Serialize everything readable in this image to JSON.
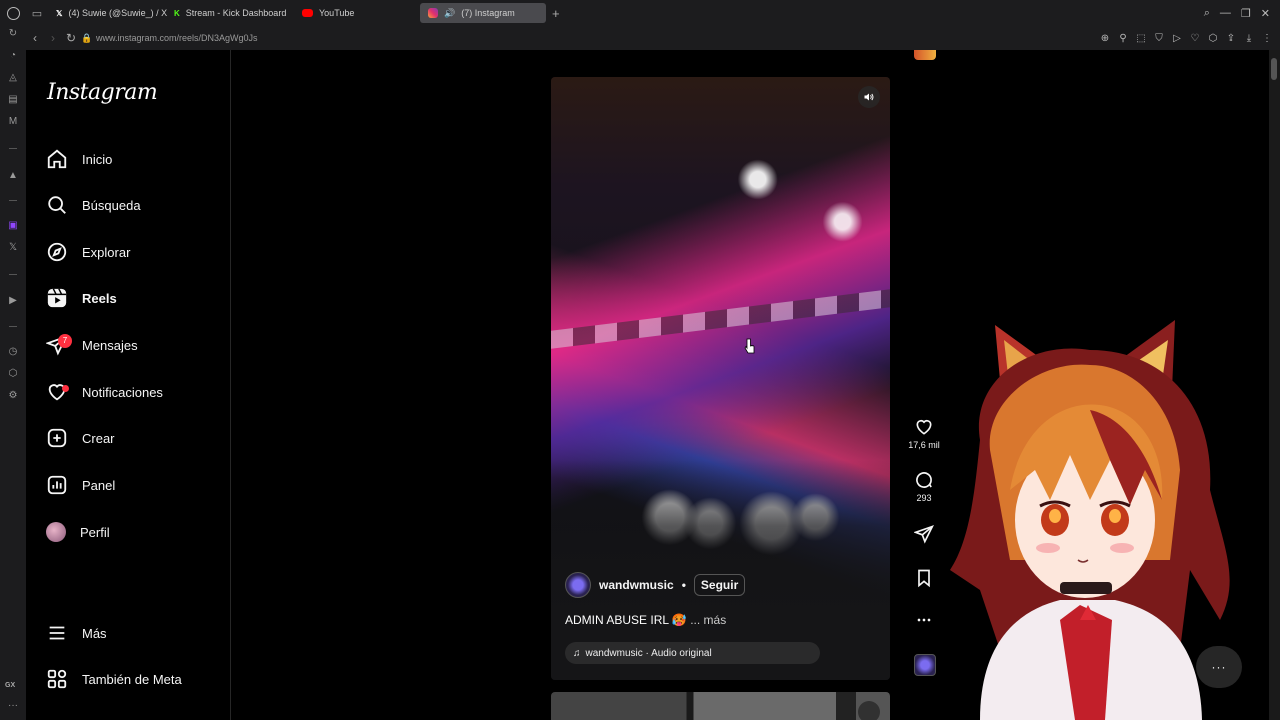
{
  "browser": {
    "tabs": [
      {
        "title": "(4) Suwie (@Suwie_) / X",
        "icon": "x-icon"
      },
      {
        "title": "Stream - Kick Dashboard",
        "icon": "kick-icon"
      },
      {
        "title": "YouTube",
        "icon": "youtube-icon"
      },
      {
        "title": "(7) Instagram",
        "icon": "instagram-icon",
        "active": true
      }
    ],
    "url": "www.instagram.com/reels/DN3AgWg0Js",
    "rail_label": "GX"
  },
  "instagram": {
    "logo": "Instagram",
    "nav": [
      {
        "label": "Inicio",
        "icon": "home-icon"
      },
      {
        "label": "Búsqueda",
        "icon": "search-icon"
      },
      {
        "label": "Explorar",
        "icon": "compass-icon"
      },
      {
        "label": "Reels",
        "icon": "reels-icon",
        "active": true
      },
      {
        "label": "Mensajes",
        "icon": "messages-icon",
        "badge": "7"
      },
      {
        "label": "Notificaciones",
        "icon": "heart-icon"
      },
      {
        "label": "Crear",
        "icon": "plus-square-icon"
      },
      {
        "label": "Panel",
        "icon": "chart-icon"
      },
      {
        "label": "Perfil",
        "icon": "avatar"
      }
    ],
    "nav_bottom": [
      {
        "label": "Más",
        "icon": "menu-icon"
      },
      {
        "label": "También de Meta",
        "icon": "meta-icon"
      }
    ],
    "reel": {
      "username": "wandwmusic",
      "separator": "•",
      "follow_label": "Seguir",
      "caption": "ADMIN ABUSE IRL 🥵",
      "more_label": "... más",
      "audio": "wandwmusic · Audio original",
      "likes": "17,6 mil",
      "comments": "293"
    },
    "chat_label": "···"
  },
  "colors": {
    "badge": "#ff3040",
    "background": "#000000"
  }
}
